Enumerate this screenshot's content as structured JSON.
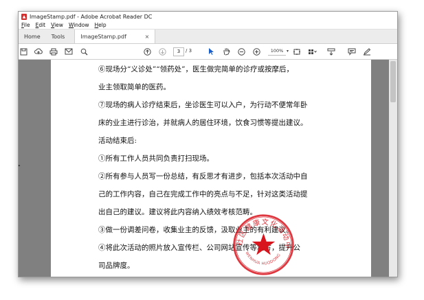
{
  "window": {
    "title": "ImageStamp.pdf - Adobe Acrobat Reader DC"
  },
  "menu": [
    "File",
    "Edit",
    "View",
    "Window",
    "Help"
  ],
  "tabs": {
    "home": "Home",
    "tools": "Tools",
    "document": "ImageStamp.pdf",
    "close": "×"
  },
  "toolbar": {
    "page_current": "3",
    "page_total": "/ 3",
    "zoom": "100%"
  },
  "document": {
    "lines": [
      "⑥现场分“义诊处”“领药处”，医生做完简单的诊疗或按摩后，",
      "业主领取简单的医药。",
      "⑦现场的病人诊疗结束后，坐诊医生可以入户，为行动不便常年卧",
      "床的业主进行诊治，并就病人的居住环境，饮食习惯等提出建议。",
      "活动结束后:",
      "①所有工作人员共同负责打扫现场。",
      "②所有参与人员写一份总结，有反思才有进步，包括本次活动中自",
      "己的工作内容，自己在完成工作中的亮点与不足，针对这类活动提",
      "出自己的建议。建议将此内容纳入绩效考核范畴。",
      "③做一份调差问卷，收集业主的反馈，汲取业主的有利建议。",
      "④将此次活动的照片放入宣传栏、公司网站宣传等地方，提升公",
      "司品牌度。"
    ]
  },
  "stamp": {
    "text_cn": "社区健康文化活动中心",
    "text_en": "WENHUA HUODONG CENTER",
    "color": "#d8141d"
  }
}
